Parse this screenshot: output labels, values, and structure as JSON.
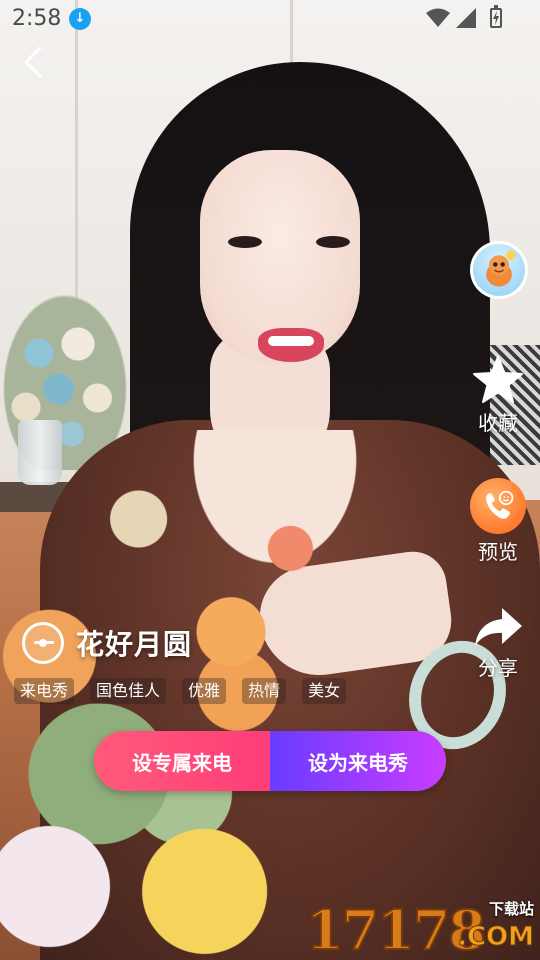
{
  "status_bar": {
    "time": "2:58",
    "download_badge": "↓"
  },
  "video": {
    "title": "花好月圆",
    "tags": [
      "来电秀",
      "国色佳人",
      "优雅",
      "热情",
      "美女"
    ]
  },
  "rail": {
    "favorite_label": "收藏",
    "preview_label": "预览",
    "share_label": "分享"
  },
  "actions": {
    "set_exclusive_label": "设专属来电",
    "set_as_caller_show_label": "设为来电秀"
  },
  "watermark": {
    "number": "17178",
    "sub": "下载站",
    "domain": ".COM"
  },
  "colors": {
    "left_button": "#ff4d79",
    "right_button_start": "#6a3cff",
    "right_button_end": "#c93cff",
    "preview_icon": "#ff7a2e"
  }
}
